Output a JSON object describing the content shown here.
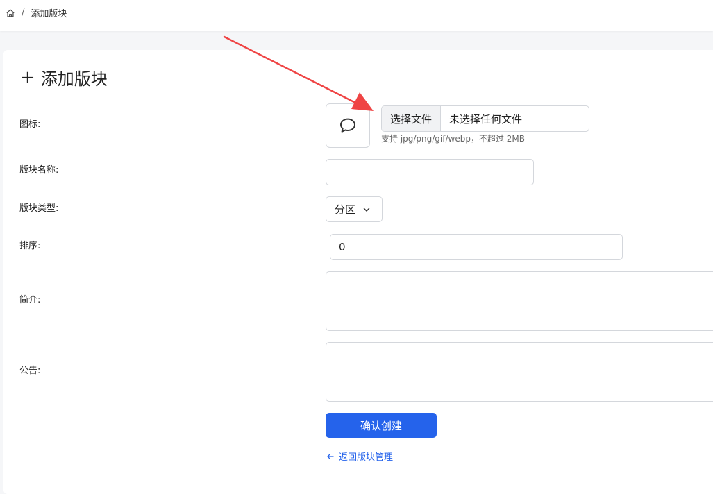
{
  "breadcrumb": {
    "home_icon": "home-icon",
    "separator": "/",
    "current": "添加版块"
  },
  "page": {
    "title_icon": "+",
    "title": "添加版块"
  },
  "form": {
    "icon": {
      "label": "图标:",
      "preview_icon": "chat-bubble-icon",
      "file_button": "选择文件",
      "file_name": "未选择任何文件",
      "hint": "支持 jpg/png/gif/webp，不超过 2MB"
    },
    "name": {
      "label": "版块名称:",
      "value": ""
    },
    "type": {
      "label": "版块类型:",
      "selected": "分区"
    },
    "order": {
      "label": "排序:",
      "value": "0"
    },
    "intro": {
      "label": "简介:",
      "value": ""
    },
    "notice": {
      "label": "公告:",
      "value": ""
    },
    "submit": "确认创建",
    "back": "返回版块管理"
  },
  "colors": {
    "primary": "#2563eb",
    "annotation_arrow": "#ef4444"
  }
}
